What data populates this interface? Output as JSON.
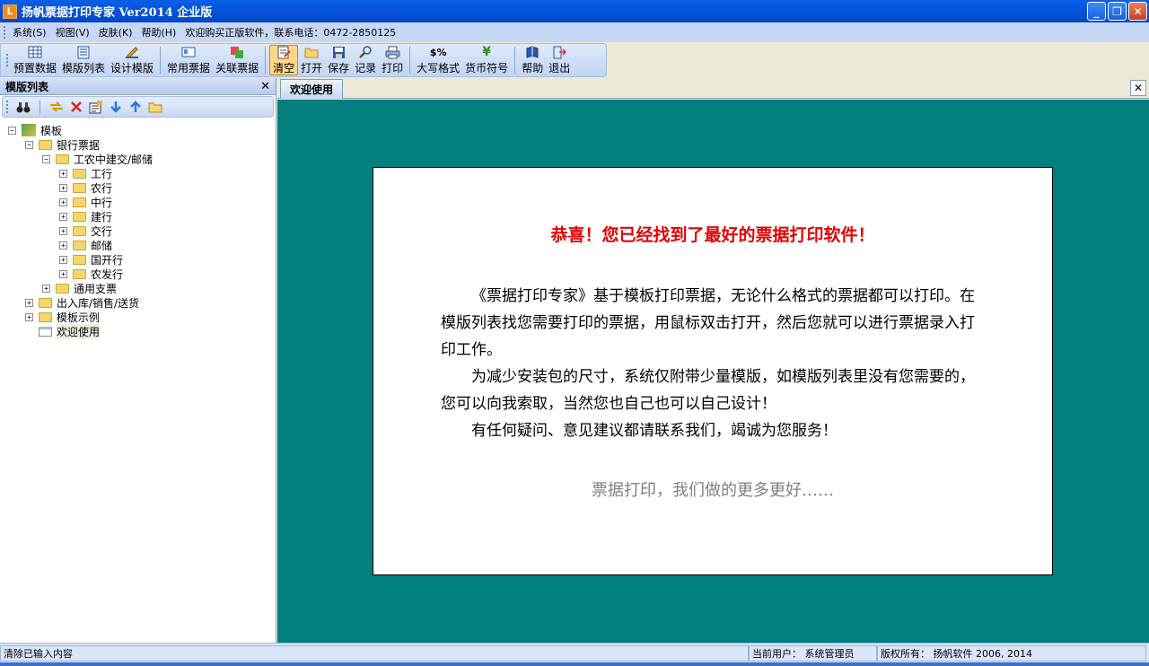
{
  "window": {
    "title": "扬帆票据打印专家 Ver2014 企业版",
    "app_icon_glyph": "L",
    "minimize_glyph": "_",
    "maximize_glyph": "❐",
    "close_glyph": "✕"
  },
  "menubar": {
    "items": [
      "系统(S)",
      "视图(V)",
      "皮肤(K)",
      "帮助(H)",
      "欢迎购买正版软件，联系电话：0472-2850125"
    ]
  },
  "toolbar": {
    "buttons": [
      {
        "label": "预置数据",
        "icon": "table-icon"
      },
      {
        "label": "模版列表",
        "icon": "list-icon"
      },
      {
        "label": "设计模版",
        "icon": "design-icon"
      },
      {
        "label": "常用票据",
        "icon": "ticket-icon"
      },
      {
        "label": "关联票据",
        "icon": "link-ticket-icon"
      },
      {
        "label": "清空",
        "icon": "clear-icon"
      },
      {
        "label": "打开",
        "icon": "open-folder-icon"
      },
      {
        "label": "保存",
        "icon": "save-icon"
      },
      {
        "label": "记录",
        "icon": "search-icon"
      },
      {
        "label": "打印",
        "icon": "printer-icon"
      },
      {
        "label": "大写格式",
        "icon": "format-icon",
        "glyph": "$%"
      },
      {
        "label": "货币符号",
        "icon": "currency-icon",
        "glyph": "¥"
      },
      {
        "label": "帮助",
        "icon": "help-book-icon"
      },
      {
        "label": "退出",
        "icon": "exit-icon"
      }
    ],
    "active": "清空"
  },
  "left_panel": {
    "title": "模版列表",
    "close_glyph": "✕",
    "tree": {
      "root": "模板",
      "nodes": [
        {
          "label": "银行票据"
        },
        {
          "label": "工农中建交/邮储"
        },
        {
          "label": "工行"
        },
        {
          "label": "农行"
        },
        {
          "label": "中行"
        },
        {
          "label": "建行"
        },
        {
          "label": "交行"
        },
        {
          "label": "邮储"
        },
        {
          "label": "国开行"
        },
        {
          "label": "农发行"
        },
        {
          "label": "通用支票"
        },
        {
          "label": "出入库/销售/送货"
        },
        {
          "label": "模板示例"
        },
        {
          "label": "欢迎使用"
        }
      ]
    }
  },
  "tabs": {
    "active_label": "欢迎使用",
    "close_glyph": "✕"
  },
  "welcome": {
    "headline": "恭喜！您已经找到了最好的票据打印软件！",
    "paragraphs": [
      "《票据打印专家》基于模板打印票据，无论什么格式的票据都可以打印。在模版列表找您需要打印的票据，用鼠标双击打开，然后您就可以进行票据录入打印工作。",
      "为减少安装包的尺寸，系统仅附带少量模版，如模版列表里没有您需要的，您可以向我索取，当然您也自己也可以自己设计！",
      "有任何疑问、意见建议都请联系我们，竭诚为您服务！"
    ],
    "tagline": "票据打印，我们做的更多更好……"
  },
  "statusbar": {
    "message": "清除已输入内容",
    "user": "当前用户：  系统管理员",
    "copyright": "版权所有：  扬帆软件  2006, 2014"
  },
  "colors": {
    "content_bg": "#007f7f",
    "headline": "#e60000",
    "titlebar": "#0553d8"
  }
}
